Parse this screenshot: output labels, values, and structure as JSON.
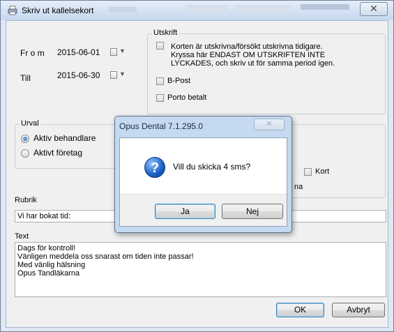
{
  "window": {
    "title": "Skriv ut kallelsekort",
    "close_glyph": "✕"
  },
  "period": {
    "from_label": "Fr o m",
    "from_value": "2015-06-01",
    "to_label": "Till",
    "to_value": "2015-06-30"
  },
  "utskrift": {
    "title": "Utskrift",
    "reprint_lines": [
      "Korten är utskrivna/försökt utskrivna tidigare.",
      "Kryssa här ENDAST OM UTSKRIFTEN INTE",
      "LYCKADES, och skriv ut för samma period igen."
    ],
    "bpost_label": "B-Post",
    "porto_label": "Porto betalt"
  },
  "urval": {
    "title": "Urval",
    "option_behandlare": "Aktiv behandlare",
    "option_foretag": "Aktivt företag"
  },
  "options": {
    "kort_label": "Kort",
    "partial_text": "na"
  },
  "rubrik": {
    "label": "Rubrik",
    "value": "Vi har bokat tid:"
  },
  "text_field": {
    "label": "Text",
    "lines": [
      "Dags för kontroll!",
      "Vänligen meddela oss snarast om tiden inte passar!",
      "Med vänlig hälsning",
      "Opus Tandläkarna"
    ]
  },
  "buttons": {
    "ok": "OK",
    "cancel": "Avbryt"
  },
  "dialog": {
    "title": "Opus Dental 7.1.295.0",
    "close_glyph": "✕",
    "message": "Vill du skicka 4 sms?",
    "icon_glyph": "?",
    "yes": "Ja",
    "no": "Nej"
  }
}
